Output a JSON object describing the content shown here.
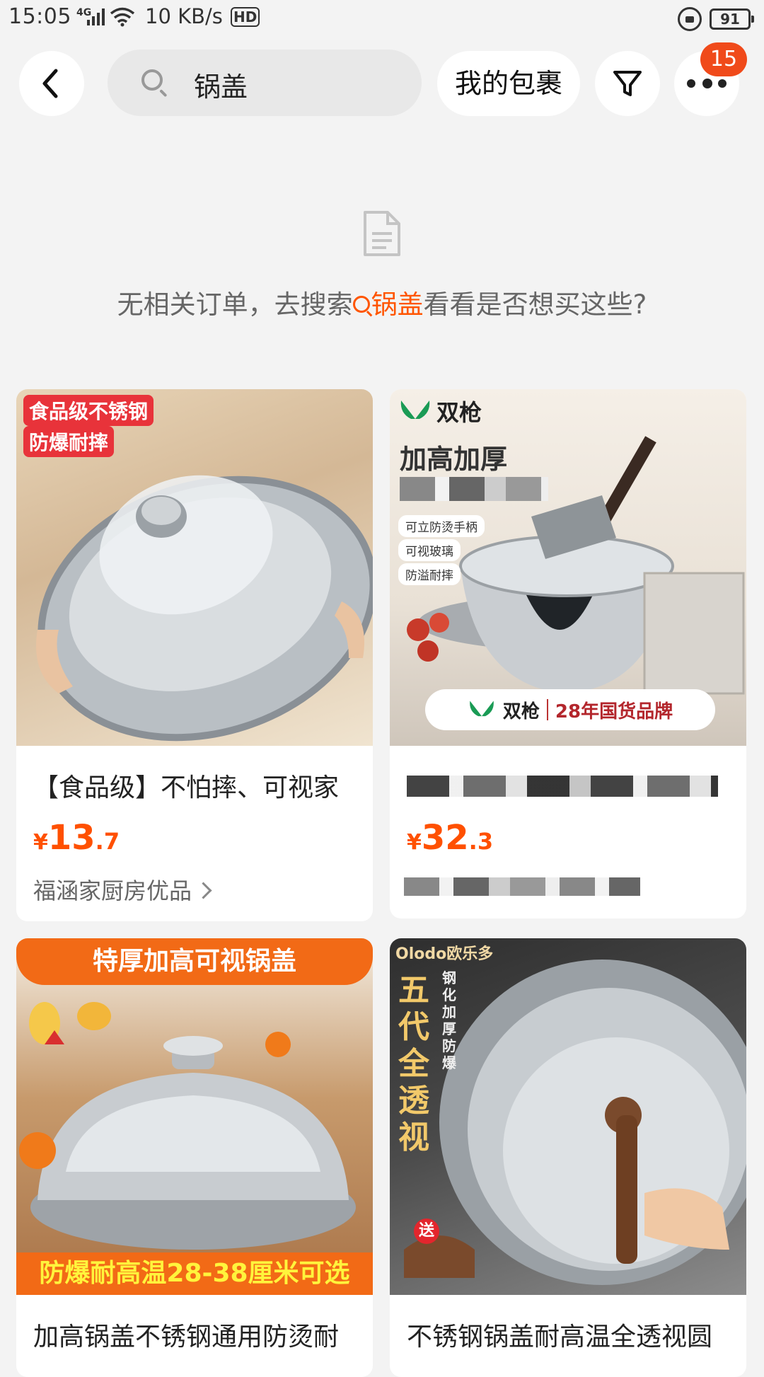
{
  "status_bar": {
    "time": "15:05",
    "network": "4G",
    "speed": "10 KB/s",
    "hd": "HD",
    "battery": "91"
  },
  "header": {
    "search_query": "锅盖",
    "package_button": "我的包裹",
    "notification_count": "15"
  },
  "empty_state": {
    "prefix": "无相关订单，去搜索",
    "keyword": "锅盖",
    "suffix": "看看是否想买这些?"
  },
  "products": [
    {
      "image_tags": [
        "食品级不锈钢",
        "防爆耐摔"
      ],
      "title": "【食品级】不怕摔、可视家",
      "price_currency": "¥",
      "price_int": "13",
      "price_dec": ".7",
      "shop": "福涵家厨房优品"
    },
    {
      "brand": "双枪",
      "image_headline": "加高加厚",
      "image_features": [
        "可立防烫手柄",
        "可视玻璃",
        "防溢耐摔"
      ],
      "image_footer": "28年国货品牌",
      "title": "",
      "price_currency": "¥",
      "price_int": "32",
      "price_dec": ".3",
      "shop": ""
    },
    {
      "image_banner": "特厚加高可视锅盖",
      "image_footer": "防爆耐高温28-38厘米可选",
      "title": "加高锅盖不锈钢通用防烫耐"
    },
    {
      "brand": "Olodo欧乐多",
      "image_vertical": "五代全透视",
      "image_vertical_small": "钢化加厚防爆",
      "image_gift": "送",
      "title": "不锈钢锅盖耐高温全透视圆"
    }
  ],
  "colors": {
    "accent": "#ff5000",
    "badge": "#f04a1a",
    "background": "#f3f3f3"
  }
}
